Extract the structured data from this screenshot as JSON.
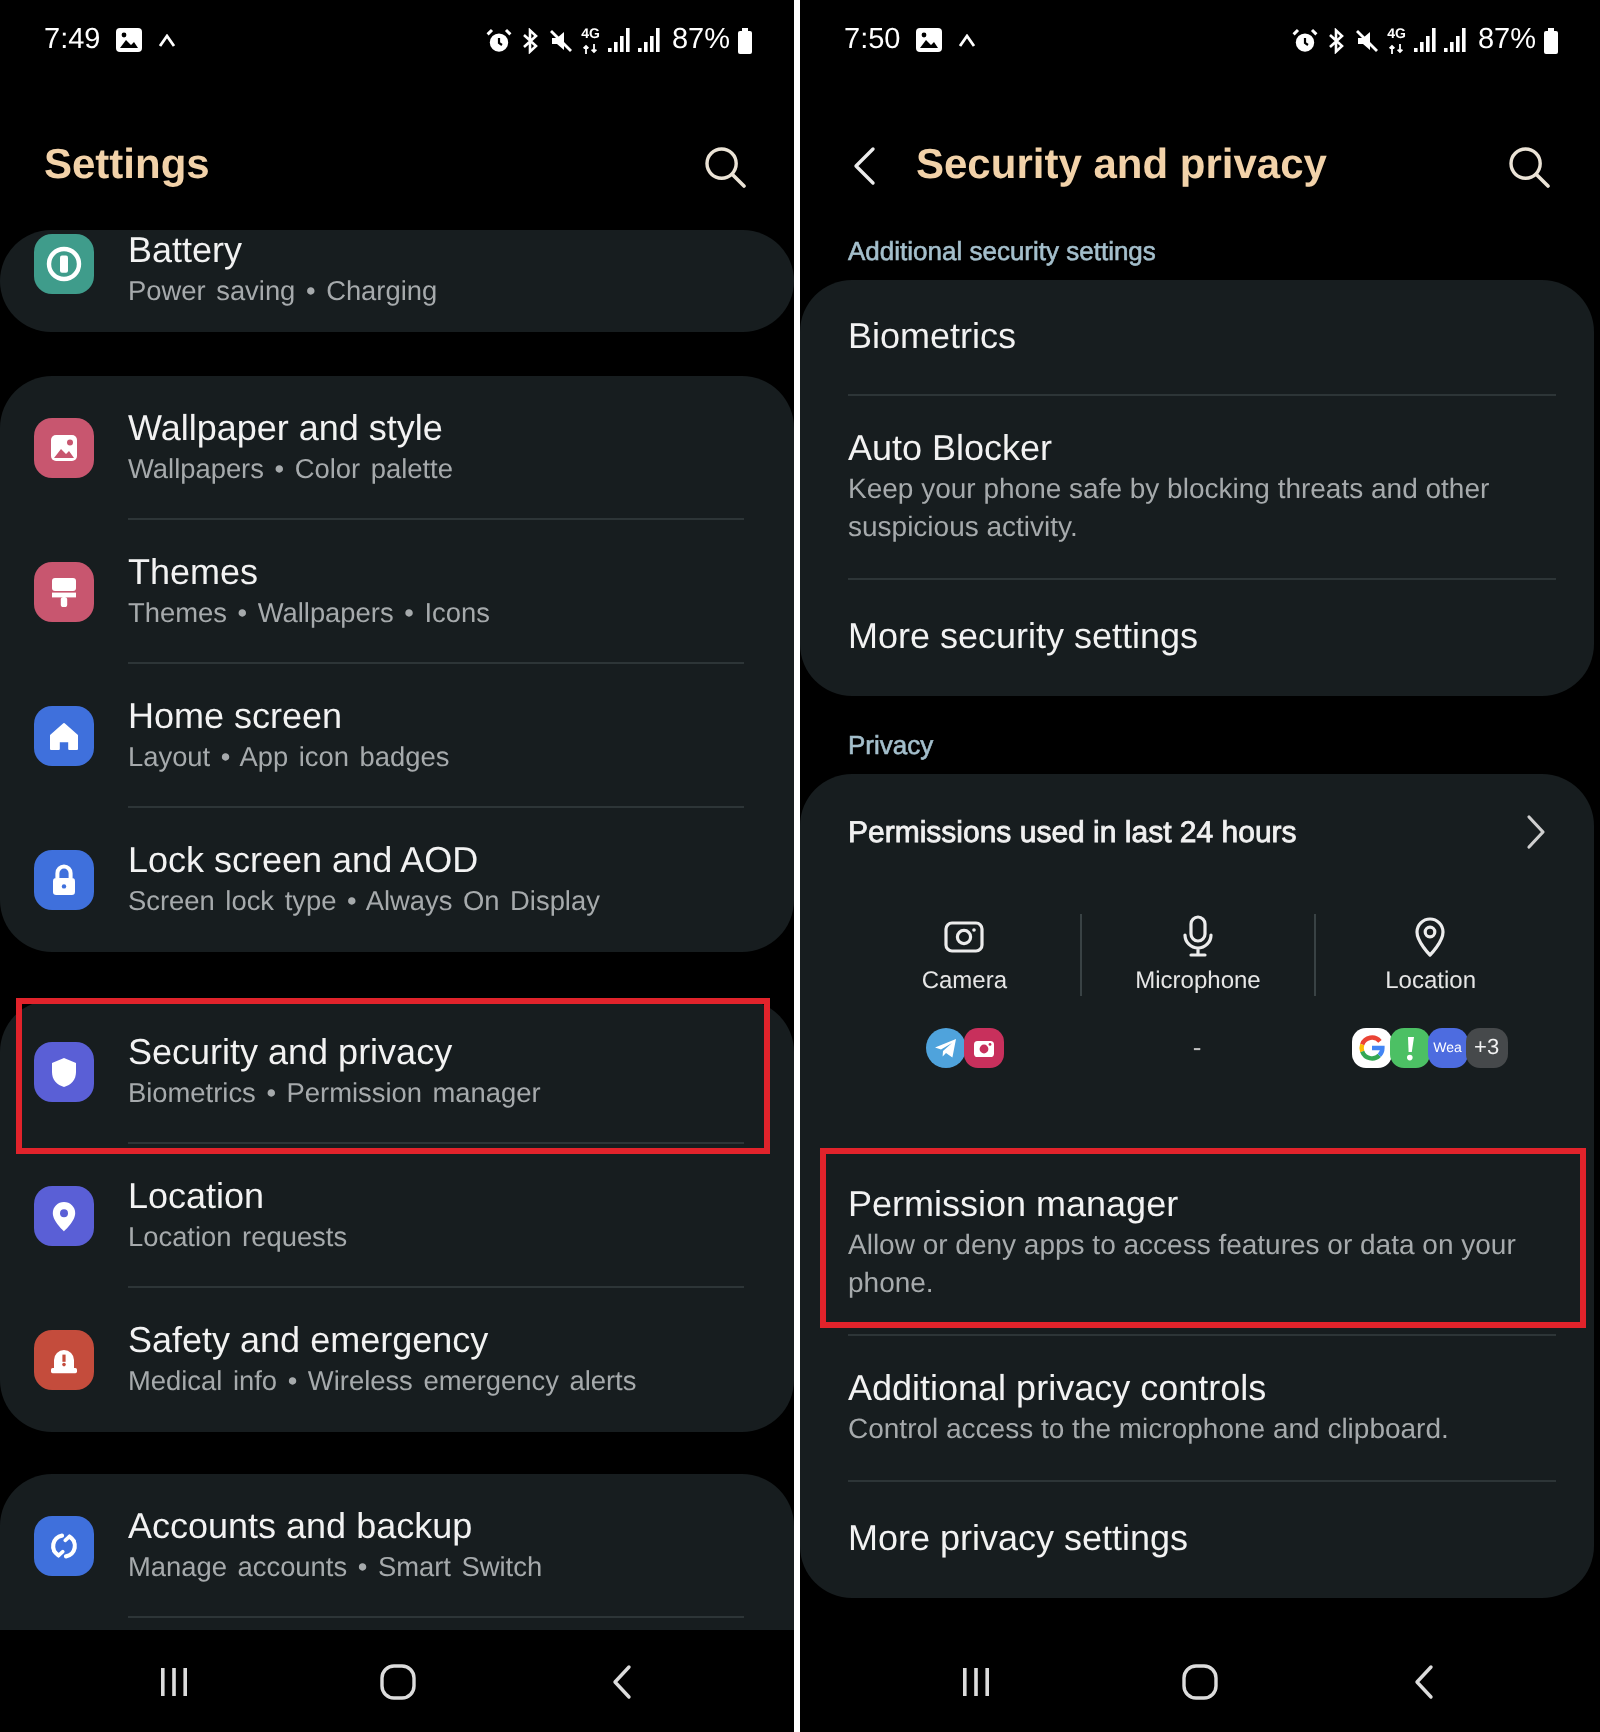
{
  "settings_screen": {
    "status_bar": {
      "time": "7:49",
      "network": "4G",
      "battery": "87%"
    },
    "header": {
      "title": "Settings",
      "back": false
    },
    "groups": [
      {
        "items": [
          {
            "title": "Battery",
            "subtitle": "Power saving • Charging",
            "color": "#3f9c8b",
            "highlighted": false
          }
        ]
      },
      {
        "items": [
          {
            "title": "Wallpaper and style",
            "subtitle": "Wallpapers • Color palette",
            "color": "#c8566f",
            "highlighted": false
          },
          {
            "title": "Themes",
            "subtitle": "Themes • Wallpapers • Icons",
            "color": "#c8566f",
            "highlighted": false
          },
          {
            "title": "Home screen",
            "subtitle": "Layout • App icon badges",
            "color": "#3f70dc",
            "highlighted": false
          },
          {
            "title": "Lock screen and AOD",
            "subtitle": "Screen lock type • Always On Display",
            "color": "#3f70dc",
            "highlighted": false
          }
        ]
      },
      {
        "items": [
          {
            "title": "Security and privacy",
            "subtitle": "Biometrics • Permission manager",
            "color": "#5a5fd6",
            "highlighted": true
          },
          {
            "title": "Location",
            "subtitle": "Location requests",
            "color": "#5a5fd6",
            "highlighted": false
          },
          {
            "title": "Safety and emergency",
            "subtitle": "Medical info • Wireless emergency alerts",
            "color": "#c44c3c",
            "highlighted": false
          }
        ]
      },
      {
        "items": [
          {
            "title": "Accounts and backup",
            "subtitle": "Manage accounts • Smart Switch",
            "color": "#3f70dc",
            "highlighted": false
          }
        ]
      }
    ]
  },
  "security_screen": {
    "status_bar": {
      "time": "7:50",
      "network": "4G",
      "battery": "87%"
    },
    "header": {
      "title": "Security and privacy",
      "back": true
    },
    "sections": [
      {
        "label": "Additional security settings",
        "items": [
          {
            "title": "Biometrics",
            "highlighted": false
          },
          {
            "title": "Auto Blocker",
            "subtitle": "Keep your phone safe by blocking threats and other suspicious activity.",
            "highlighted": false
          },
          {
            "title": "More security settings",
            "highlighted": false
          }
        ]
      },
      {
        "label": "Privacy",
        "permissions": {
          "title": "Permissions used in last 24 hours",
          "columns": [
            {
              "label": "Camera",
              "apps": [
                {
                  "color": "#4fa3dc"
                },
                {
                  "color": "#c8305c"
                }
              ]
            },
            {
              "label": "Microphone",
              "no_apps": "-"
            },
            {
              "label": "Location",
              "apps": [
                {
                  "color": "#ffffff"
                },
                {
                  "color": "#4cc064"
                },
                {
                  "color": "#4d6ce0",
                  "label": "Wea"
                }
              ],
              "more": "+3"
            }
          ]
        },
        "items": [
          {
            "title": "Permission manager",
            "subtitle": "Allow or deny apps to access features or data on your phone.",
            "highlighted": true
          },
          {
            "title": "Additional privacy controls",
            "subtitle": "Control access to the microphone and clipboard.",
            "highlighted": false
          },
          {
            "title": "More privacy settings",
            "highlighted": false
          }
        ]
      }
    ]
  }
}
